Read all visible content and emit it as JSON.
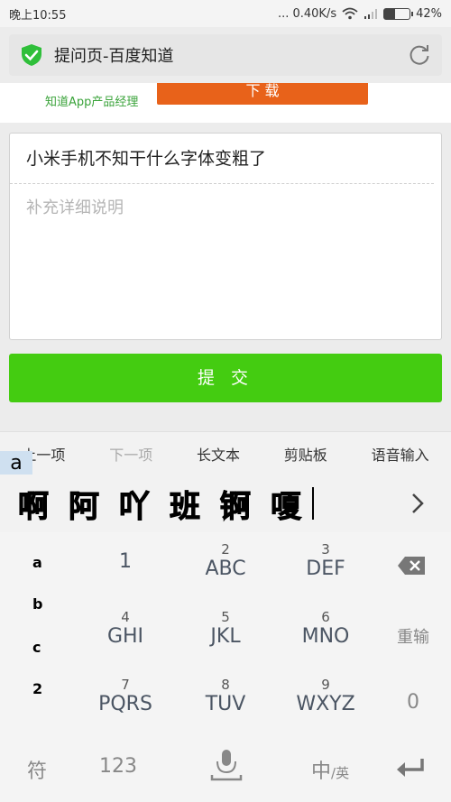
{
  "status": {
    "time": "晚上10:55",
    "speed": "... 0.40K/s",
    "battery_pct": "42%",
    "battery_level": 0.42
  },
  "address": {
    "title": "提问页-百度知道"
  },
  "promo": {
    "caption": "知道App产品经理",
    "button": "下 载"
  },
  "editor": {
    "title_value": "小米手机不知干什么字体变粗了",
    "detail_placeholder": "补充详细说明"
  },
  "submit": {
    "label": "提 交"
  },
  "ime_toolbar": {
    "prev": "上一项",
    "next": "下一项",
    "long_text": "长文本",
    "clipboard": "剪贴板",
    "voice": "语音输入"
  },
  "preedit": "a",
  "candidates": [
    "啊",
    "阿",
    "吖",
    "班",
    "锕",
    "嗄"
  ],
  "left_keys": [
    "a",
    "b",
    "c",
    "2"
  ],
  "keys": [
    {
      "num": "",
      "letters": "1"
    },
    {
      "num": "2",
      "letters": "ABC"
    },
    {
      "num": "3",
      "letters": "DEF"
    },
    {
      "num": "4",
      "letters": "GHI"
    },
    {
      "num": "5",
      "letters": "JKL"
    },
    {
      "num": "6",
      "letters": "MNO"
    },
    {
      "num": "7",
      "letters": "PQRS"
    },
    {
      "num": "8",
      "letters": "TUV"
    },
    {
      "num": "9",
      "letters": "WXYZ"
    }
  ],
  "right_keys": {
    "redo": "重输",
    "zero": "0"
  },
  "bottom": {
    "symbol": "符",
    "numeric": "123",
    "lang_zh": "中",
    "lang_en": "/英"
  },
  "icons": {
    "secure": "shield-check-icon",
    "refresh": "refresh-icon",
    "backspace": "backspace-icon",
    "mic": "microphone-icon",
    "enter": "enter-icon",
    "more": "chevron-right-icon"
  },
  "colors": {
    "submit": "#44cc11",
    "promo_button": "#e8621a",
    "shield": "#2fbf3a"
  }
}
